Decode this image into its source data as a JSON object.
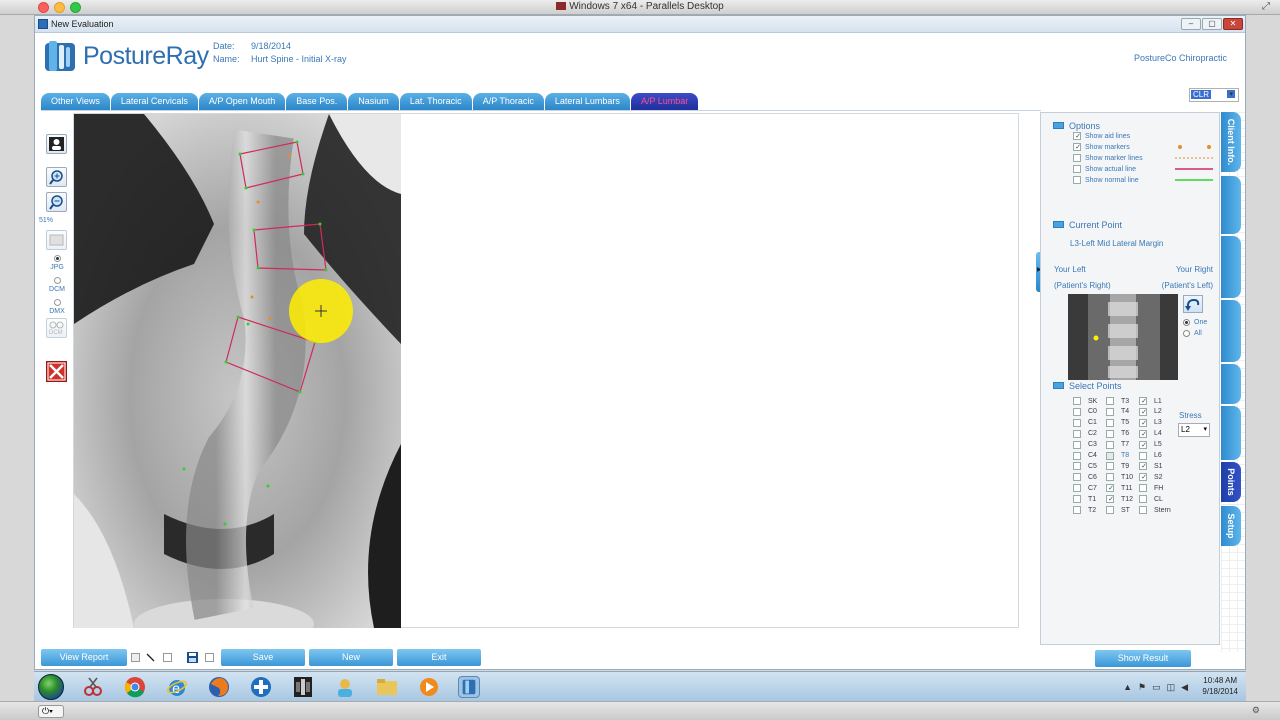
{
  "mac": {
    "title": "Windows 7 x64 - Parallels Desktop"
  },
  "window": {
    "title": "New Evaluation",
    "minimize": "‒",
    "maximize": "▢",
    "close": "✕"
  },
  "header": {
    "logo_text": "PostureRay",
    "date_label": "Date:",
    "date_value": "9/18/2014",
    "name_label": "Name:",
    "name_value": "Hurt Spine - Initial X-ray",
    "clinic": "PostureCo Chiropractic"
  },
  "tabs": [
    {
      "label": "Other Views"
    },
    {
      "label": "Lateral Cervicals"
    },
    {
      "label": "A/P Open Mouth"
    },
    {
      "label": "Base Pos."
    },
    {
      "label": "Nasium"
    },
    {
      "label": "Lat. Thoracic"
    },
    {
      "label": "A/P Thoracic"
    },
    {
      "label": "Lateral Lumbars"
    },
    {
      "label": "A/P Lumbar",
      "active": true
    }
  ],
  "clr_select": {
    "value": "CLR"
  },
  "toolbar": {
    "zoom_level": "51%",
    "formats": [
      {
        "label": "JPG",
        "selected": true
      },
      {
        "label": "DCM",
        "selected": false
      },
      {
        "label": "DMX",
        "selected": false
      }
    ],
    "dcm_label": "DCM"
  },
  "options": {
    "title": "Options",
    "items": [
      {
        "label": "Show aid lines",
        "checked": true
      },
      {
        "label": "Show markers",
        "checked": true
      },
      {
        "label": "Show marker lines",
        "checked": false
      },
      {
        "label": "Show actual line",
        "checked": false
      },
      {
        "label": "Show normal line",
        "checked": false
      }
    ]
  },
  "current_point": {
    "title": "Current Point",
    "value": "L3-Left Mid Lateral Margin",
    "your_left": "Your Left",
    "your_right": "Your Right",
    "patient_right": "(Patient's Right)",
    "patient_left": "(Patient's Left)",
    "one": "One",
    "all": "All"
  },
  "select_points": {
    "title": "Select Points",
    "col1": [
      {
        "label": "SK",
        "checked": false
      },
      {
        "label": "C0",
        "checked": false
      },
      {
        "label": "C1",
        "checked": false
      },
      {
        "label": "C2",
        "checked": false
      },
      {
        "label": "C3",
        "checked": false
      },
      {
        "label": "C4",
        "checked": false
      },
      {
        "label": "C5",
        "checked": false
      },
      {
        "label": "C6",
        "checked": false
      },
      {
        "label": "C7",
        "checked": false
      },
      {
        "label": "T1",
        "checked": false
      },
      {
        "label": "T2",
        "checked": false
      }
    ],
    "col2": [
      {
        "label": "T3",
        "checked": false
      },
      {
        "label": "T4",
        "checked": false
      },
      {
        "label": "T5",
        "checked": false
      },
      {
        "label": "T6",
        "checked": false
      },
      {
        "label": "T7",
        "checked": false
      },
      {
        "label": "T8",
        "checked": false,
        "partial": true
      },
      {
        "label": "T9",
        "checked": false
      },
      {
        "label": "T10",
        "checked": false
      },
      {
        "label": "T11",
        "checked": true
      },
      {
        "label": "T12",
        "checked": true
      },
      {
        "label": "ST",
        "checked": false
      }
    ],
    "col3": [
      {
        "label": "L1",
        "checked": true
      },
      {
        "label": "L2",
        "checked": true
      },
      {
        "label": "L3",
        "checked": true
      },
      {
        "label": "L4",
        "checked": true
      },
      {
        "label": "L5",
        "checked": true
      },
      {
        "label": "L6",
        "checked": false
      },
      {
        "label": "S1",
        "checked": true
      },
      {
        "label": "S2",
        "checked": true
      },
      {
        "label": "FH",
        "checked": false
      },
      {
        "label": "CL",
        "checked": false
      },
      {
        "label": "Stern",
        "checked": false
      }
    ],
    "stress_label": "Stress",
    "stress_value": "L2"
  },
  "side_tabs": [
    {
      "label": "Client Info.",
      "active": false
    },
    {
      "label": "",
      "active": false
    },
    {
      "label": "",
      "active": false
    },
    {
      "label": "",
      "active": false
    },
    {
      "label": "",
      "active": false
    },
    {
      "label": "",
      "active": false
    },
    {
      "label": "Points",
      "active": true
    },
    {
      "label": "Setup",
      "active": false
    }
  ],
  "bottom": {
    "view_report": "View Report",
    "save": "Save",
    "new": "New",
    "exit": "Exit",
    "show_result": "Show Result"
  },
  "taskbar": {
    "time": "10:48 AM",
    "date": "9/18/2014"
  }
}
